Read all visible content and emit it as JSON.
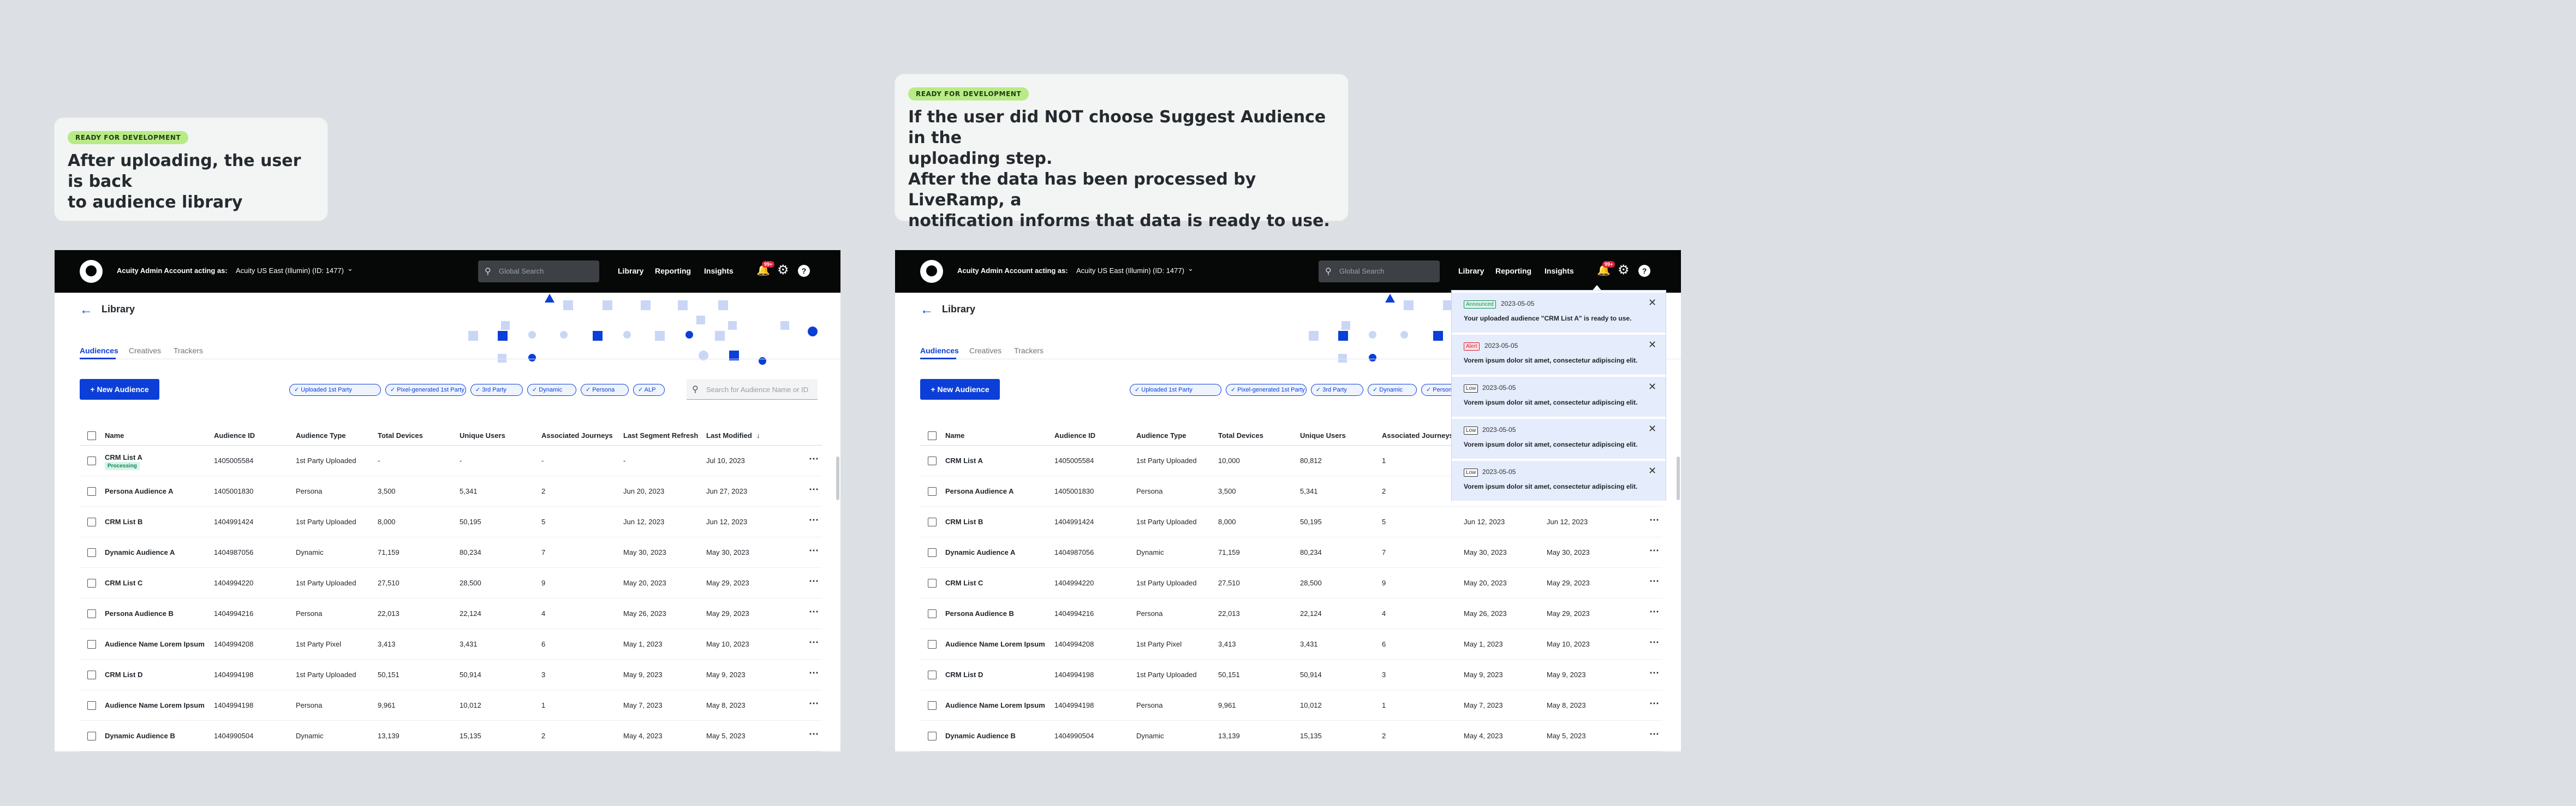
{
  "cards": [
    {
      "badge": "READY FOR DEVELOPMENT",
      "lines": [
        "After uploading, the user is back",
        "to audience library"
      ]
    },
    {
      "badge": "READY FOR DEVELOPMENT",
      "lines": [
        "If the user did NOT choose Suggest Audience in the",
        "uploading step.",
        "After the data has been processed by LiveRamp, a",
        "notification informs that data is ready to use."
      ]
    }
  ],
  "topbar": {
    "account_label": "Acuity Admin Account acting as:",
    "account_value": "Acuity US East (Illumin) (ID: 1477)",
    "search_placeholder": "Global Search",
    "nav": [
      "Library",
      "Reporting",
      "Insights"
    ],
    "bell_badge": "99+",
    "help": "?"
  },
  "page": {
    "title": "Library",
    "tabs": [
      "Audiences",
      "Creatives",
      "Trackers"
    ],
    "new_button": "New Audience",
    "filters": [
      "Uploaded 1st Party",
      "Pixel-generated 1st Party",
      "3rd Party",
      "Dynamic",
      "Persona",
      "ALP"
    ],
    "search_placeholder": "Search for Audience Name or ID"
  },
  "table": {
    "columns": [
      "Name",
      "Audience ID",
      "Audience Type",
      "Total Devices",
      "Unique Users",
      "Associated Journeys",
      "Last Segment Refresh",
      "Last Modified"
    ],
    "sort_indicator": "↓",
    "rows_left": [
      [
        "CRM List A",
        "1405005584",
        "1st Party Uploaded",
        "-",
        "-",
        "-",
        "-",
        "Jul 10, 2023"
      ],
      [
        "Persona Audience A",
        "1405001830",
        "Persona",
        "3,500",
        "5,341",
        "2",
        "Jun 20, 2023",
        "Jun 27, 2023"
      ],
      [
        "CRM List B",
        "1404991424",
        "1st Party Uploaded",
        "8,000",
        "50,195",
        "5",
        "Jun 12, 2023",
        "Jun 12, 2023"
      ],
      [
        "Dynamic Audience A",
        "1404987056",
        "Dynamic",
        "71,159",
        "80,234",
        "7",
        "May 30, 2023",
        "May 30, 2023"
      ],
      [
        "CRM List C",
        "1404994220",
        "1st Party Uploaded",
        "27,510",
        "28,500",
        "9",
        "May 20, 2023",
        "May 29, 2023"
      ],
      [
        "Persona Audience B",
        "1404994216",
        "Persona",
        "22,013",
        "22,124",
        "4",
        "May 26, 2023",
        "May 29, 2023"
      ],
      [
        "Audience Name Lorem Ipsum",
        "1404994208",
        "1st Party Pixel",
        "3,413",
        "3,431",
        "6",
        "May 1, 2023",
        "May 10, 2023"
      ],
      [
        "CRM List D",
        "1404994198",
        "1st Party Uploaded",
        "50,151",
        "50,914",
        "3",
        "May 9, 2023",
        "May 9, 2023"
      ],
      [
        "Audience Name Lorem Ipsum",
        "1404994198",
        "Persona",
        "9,961",
        "10,012",
        "1",
        "May 7, 2023",
        "May 8, 2023"
      ],
      [
        "Dynamic Audience B",
        "1404990504",
        "Dynamic",
        "13,139",
        "15,135",
        "2",
        "May 4, 2023",
        "May 5, 2023"
      ]
    ],
    "rows_right": [
      [
        "CRM List A",
        "1405005584",
        "1st Party Uploaded",
        "10,000",
        "80,812",
        "1",
        "",
        ""
      ],
      [
        "Persona Audience A",
        "1405001830",
        "Persona",
        "3,500",
        "5,341",
        "2",
        "",
        ""
      ],
      [
        "CRM List B",
        "1404991424",
        "1st Party Uploaded",
        "8,000",
        "50,195",
        "5",
        "Jun 12, 2023",
        "Jun 12, 2023"
      ],
      [
        "Dynamic Audience A",
        "1404987056",
        "Dynamic",
        "71,159",
        "80,234",
        "7",
        "May 30, 2023",
        "May 30, 2023"
      ],
      [
        "CRM List C",
        "1404994220",
        "1st Party Uploaded",
        "27,510",
        "28,500",
        "9",
        "May 20, 2023",
        "May 29, 2023"
      ],
      [
        "Persona Audience B",
        "1404994216",
        "Persona",
        "22,013",
        "22,124",
        "4",
        "May 26, 2023",
        "May 29, 2023"
      ],
      [
        "Audience Name Lorem Ipsum",
        "1404994208",
        "1st Party Pixel",
        "3,413",
        "3,431",
        "6",
        "May 1, 2023",
        "May 10, 2023"
      ],
      [
        "CRM List D",
        "1404994198",
        "1st Party Uploaded",
        "50,151",
        "50,914",
        "3",
        "May 9, 2023",
        "May 9, 2023"
      ],
      [
        "Audience Name Lorem Ipsum",
        "1404994198",
        "Persona",
        "9,961",
        "10,012",
        "1",
        "May 7, 2023",
        "May 8, 2023"
      ],
      [
        "Dynamic Audience B",
        "1404990504",
        "Dynamic",
        "13,139",
        "15,135",
        "2",
        "May 4, 2023",
        "May 5, 2023"
      ]
    ],
    "processing_label": "Processing"
  },
  "notifications": [
    {
      "tag": "Announced",
      "kind": "ann",
      "date": "2023-05-05",
      "message": "Your uploaded audience \"CRM List A\" is ready to use."
    },
    {
      "tag": "Alert",
      "kind": "alert",
      "date": "2023-05-05",
      "message": "Vorem ipsum dolor sit amet, consectetur adipiscing elit."
    },
    {
      "tag": "Low",
      "kind": "low",
      "date": "2023-05-05",
      "message": "Vorem ipsum dolor sit amet, consectetur adipiscing elit."
    },
    {
      "tag": "Low",
      "kind": "low",
      "date": "2023-05-05",
      "message": "Vorem ipsum dolor sit amet, consectetur adipiscing elit."
    },
    {
      "tag": "Low",
      "kind": "low",
      "date": "2023-05-05",
      "message": "Vorem ipsum dolor sit amet, consectetur adipiscing elit."
    }
  ],
  "icons": {
    "search": "search-icon",
    "bell": "bell-icon",
    "gear": "gear-icon",
    "help": "help-icon",
    "back": "back-arrow-icon",
    "check": "check-icon",
    "more": "more-icon",
    "close": "close-icon",
    "chevron": "chevron-down-icon"
  },
  "colors": {
    "accent": "#0b3fd8",
    "topbar": "#060707",
    "badge": "#b8ea86",
    "processing": "#0a8a55",
    "alert": "#d61f38"
  }
}
